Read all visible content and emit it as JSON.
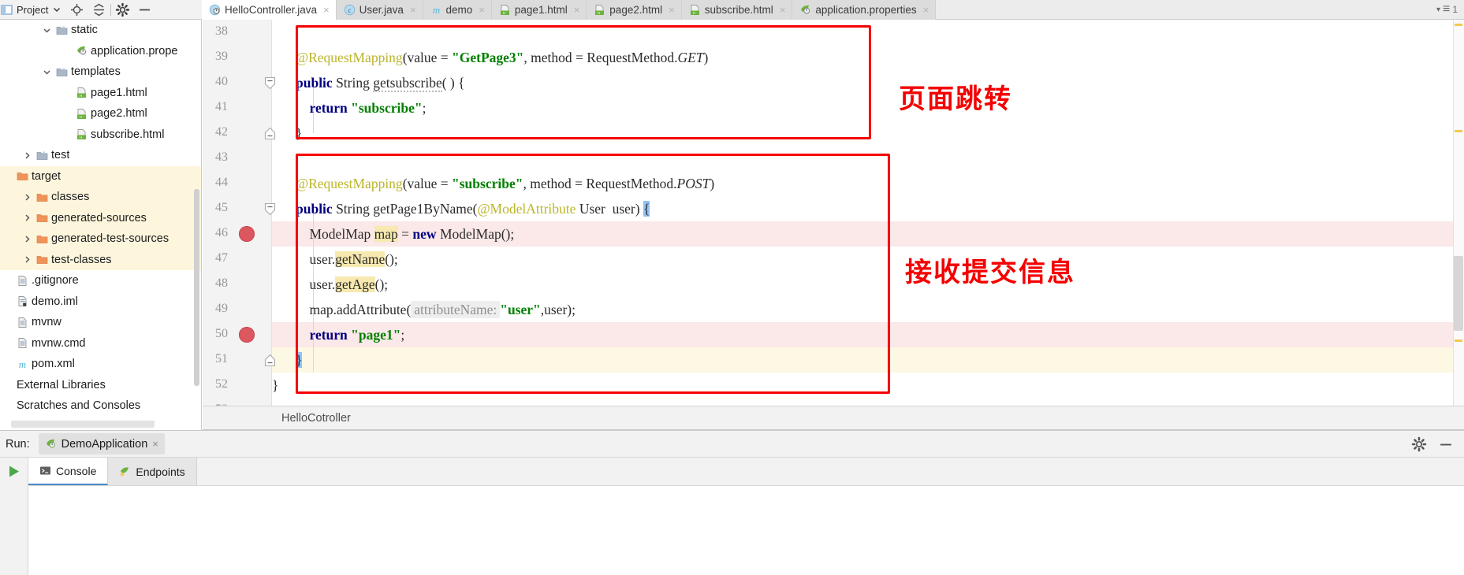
{
  "window": {
    "project_toolbar": {
      "label": "Project",
      "icons": [
        "project-view-icon",
        "chevron-down-icon",
        "locate-icon",
        "collapse-all-icon",
        "settings-gear-icon",
        "hide-icon"
      ]
    }
  },
  "project_tree": {
    "items": [
      {
        "label": "static",
        "indent": 2,
        "twisty": "down",
        "icon": "folder-icon",
        "highlight": false
      },
      {
        "label": "application.prope",
        "indent": 3,
        "twisty": "none",
        "icon": "properties-icon",
        "highlight": false
      },
      {
        "label": "templates",
        "indent": 2,
        "twisty": "down",
        "icon": "folder-icon",
        "highlight": false
      },
      {
        "label": "page1.html",
        "indent": 3,
        "twisty": "none",
        "icon": "html-icon",
        "highlight": false
      },
      {
        "label": "page2.html",
        "indent": 3,
        "twisty": "none",
        "icon": "html-icon",
        "highlight": false
      },
      {
        "label": "subscribe.html",
        "indent": 3,
        "twisty": "none",
        "icon": "html-icon",
        "highlight": false
      },
      {
        "label": "test",
        "indent": 1,
        "twisty": "right",
        "icon": "folder-icon",
        "highlight": false
      },
      {
        "label": "target",
        "indent": 0,
        "twisty": "none",
        "icon": "folder-orange-icon",
        "highlight": true
      },
      {
        "label": "classes",
        "indent": 1,
        "twisty": "right",
        "icon": "folder-orange-icon",
        "highlight": true
      },
      {
        "label": "generated-sources",
        "indent": 1,
        "twisty": "right",
        "icon": "folder-orange-icon",
        "highlight": true
      },
      {
        "label": "generated-test-sources",
        "indent": 1,
        "twisty": "right",
        "icon": "folder-orange-icon",
        "highlight": true
      },
      {
        "label": "test-classes",
        "indent": 1,
        "twisty": "right",
        "icon": "folder-orange-icon",
        "highlight": true
      },
      {
        "label": ".gitignore",
        "indent": 0,
        "twisty": "none",
        "icon": "file-icon",
        "highlight": false
      },
      {
        "label": "demo.iml",
        "indent": 0,
        "twisty": "none",
        "icon": "iml-icon",
        "highlight": false
      },
      {
        "label": "mvnw",
        "indent": 0,
        "twisty": "none",
        "icon": "file-icon",
        "highlight": false
      },
      {
        "label": "mvnw.cmd",
        "indent": 0,
        "twisty": "none",
        "icon": "file-icon",
        "highlight": false
      },
      {
        "label": "pom.xml",
        "indent": 0,
        "twisty": "none",
        "icon": "maven-icon",
        "highlight": false
      },
      {
        "label": "External Libraries",
        "indent": 0,
        "twisty": "none",
        "icon": "none",
        "highlight": false
      },
      {
        "label": "Scratches and Consoles",
        "indent": 0,
        "twisty": "none",
        "icon": "none",
        "highlight": false
      }
    ]
  },
  "editor_tabs": {
    "items": [
      {
        "label": "HelloController.java",
        "icon": "spring-controller-icon",
        "active": true
      },
      {
        "label": "User.java",
        "icon": "java-class-icon",
        "active": false
      },
      {
        "label": "demo",
        "icon": "maven-icon",
        "active": false
      },
      {
        "label": "page1.html",
        "icon": "html-icon",
        "active": false
      },
      {
        "label": "page2.html",
        "icon": "html-icon",
        "active": false
      },
      {
        "label": "subscribe.html",
        "icon": "html-icon",
        "active": false
      },
      {
        "label": "application.properties",
        "icon": "properties-icon",
        "active": false
      }
    ],
    "close_glyph": "×",
    "right_controls": {
      "chevron": "▾",
      "list_icon": "≡",
      "count": "1"
    }
  },
  "code": {
    "lines": [
      {
        "n": "38",
        "text": "",
        "breakpoint": false,
        "fold": "none",
        "row": "none"
      },
      {
        "n": "39",
        "text": "line39",
        "breakpoint": false,
        "fold": "none",
        "row": "none"
      },
      {
        "n": "40",
        "text": "line40",
        "breakpoint": false,
        "fold": "minus",
        "row": "none"
      },
      {
        "n": "41",
        "text": "line41",
        "breakpoint": false,
        "fold": "none",
        "row": "none"
      },
      {
        "n": "42",
        "text": "line42",
        "breakpoint": false,
        "fold": "end",
        "row": "none"
      },
      {
        "n": "43",
        "text": "",
        "breakpoint": false,
        "fold": "none",
        "row": "none"
      },
      {
        "n": "44",
        "text": "line44",
        "breakpoint": false,
        "fold": "none",
        "row": "none"
      },
      {
        "n": "45",
        "text": "line45",
        "breakpoint": false,
        "fold": "minus",
        "row": "none"
      },
      {
        "n": "46",
        "text": "line46",
        "breakpoint": true,
        "fold": "none",
        "row": "error"
      },
      {
        "n": "47",
        "text": "line47",
        "breakpoint": false,
        "fold": "none",
        "row": "none"
      },
      {
        "n": "48",
        "text": "line48",
        "breakpoint": false,
        "fold": "none",
        "row": "none"
      },
      {
        "n": "49",
        "text": "line49",
        "breakpoint": false,
        "fold": "none",
        "row": "none"
      },
      {
        "n": "50",
        "text": "line50",
        "breakpoint": true,
        "fold": "none",
        "row": "error"
      },
      {
        "n": "51",
        "text": "line51",
        "breakpoint": false,
        "fold": "end",
        "row": "current"
      },
      {
        "n": "52",
        "text": "line52",
        "breakpoint": false,
        "fold": "none",
        "row": "none"
      },
      {
        "n": "53",
        "text": "",
        "breakpoint": false,
        "fold": "none",
        "row": "none"
      }
    ],
    "source": {
      "l39_annotation": "@RequestMapping",
      "l39_open": "(value = ",
      "l39_value": "\"GetPage3\"",
      "l39_mid": ", method = RequestMethod.",
      "l39_const": "GET",
      "l39_close": ")",
      "l40_kw": "public",
      "l40_type": " String ",
      "l40_name": "getsubscribe",
      "l40_rest": "( ) {",
      "l41_kw": "return",
      "l41_str": "\"subscribe\"",
      "l41_semi": ";",
      "l42_brace": "}",
      "l44_annotation": "@RequestMapping",
      "l44_open": "(value = ",
      "l44_value": "\"subscribe\"",
      "l44_mid": ", method = RequestMethod.",
      "l44_const": "POST",
      "l44_close": ")",
      "l45_kw": "public",
      "l45_type": " String ",
      "l45_name": "getPage1ByName",
      "l45_paren": "(",
      "l45_param_ann": "@ModelAttribute",
      "l45_param": " User  user)",
      "l45_brace": "{",
      "l46_type": "ModelMap ",
      "l46_var": "map",
      "l46_eq": " = ",
      "l46_kw": "new",
      "l46_ctor": " ModelMap();",
      "l47_recv": "user.",
      "l47_call": "getName",
      "l47_rest": "();",
      "l48_recv": "user.",
      "l48_call": "getAge",
      "l48_rest": "();",
      "l49_recv": "map.addAttribute(",
      "l49_hint": "attributeName:",
      "l49_str": "\"user\"",
      "l49_rest": ",user);",
      "l50_kw": "return",
      "l50_str": "\"page1\"",
      "l50_semi": ";",
      "l51_brace": "}",
      "l52_brace": "}"
    }
  },
  "annotations": {
    "note_top": "页面跳转",
    "note_bottom": "接收提交信息",
    "color": "#f40000"
  },
  "breadcrumb": {
    "text": "HelloCotroller"
  },
  "run_panel": {
    "label": "Run:",
    "configuration": "DemoApplication",
    "close_glyph": "×",
    "tools": [
      "settings-gear-icon",
      "hide-icon"
    ],
    "run_icon": "run-arrow-icon",
    "tabs": [
      {
        "label": "Console",
        "icon": "console-icon",
        "active": true
      },
      {
        "label": "Endpoints",
        "icon": "endpoints-icon",
        "active": false
      }
    ]
  },
  "colors": {
    "accent_red": "#f50000",
    "breakpoint": "#db5860",
    "error_row": "#fbe8e8",
    "current_row": "#fcf8e3",
    "highlight_row": "#fdf6dd",
    "annotation_yellow": "#bbb529",
    "string_green": "#008000",
    "keyword_blue": "#000080"
  }
}
